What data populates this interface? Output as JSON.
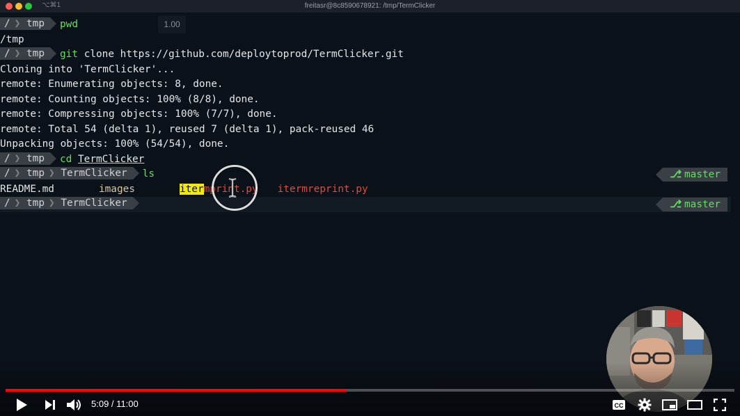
{
  "window": {
    "title": "freitasr@8c8590678921: /tmp/TermClicker",
    "tab_shortcut": "⌥⌘1"
  },
  "speed_badge": "1.00",
  "prompt": {
    "root": "/",
    "dir_tmp": "tmp",
    "dir_repo": "TermClicker",
    "branch": "master"
  },
  "terminal": {
    "cmd_pwd": "pwd",
    "out_pwd": "/tmp",
    "cmd_git": "git",
    "arg_git": "clone https://github.com/deploytoprod/TermClicker.git",
    "out_lines": [
      "Cloning into 'TermClicker'...",
      "remote: Enumerating objects: 8, done.",
      "remote: Counting objects: 100% (8/8), done.",
      "remote: Compressing objects: 100% (7/7), done.",
      "remote: Total 54 (delta 1), reused 7 (delta 1), pack-reused 46",
      "Unpacking objects: 100% (54/54), done."
    ],
    "cmd_cd": "cd",
    "arg_cd": "TermClicker",
    "cmd_ls": "ls",
    "ls_items": {
      "readme": "README.md",
      "images": "images",
      "py1_match": "iter",
      "py1_rest": "mprint.py",
      "py2": "itermreprint.py"
    }
  },
  "player": {
    "time_current": "5:09",
    "time_separator": " / ",
    "time_total": "11:00",
    "progress_fraction": 0.468,
    "accent_color": "#ff0000"
  },
  "icons": {
    "play": "play-icon",
    "next": "next-icon",
    "volume": "volume-icon",
    "cc": "captions-icon",
    "settings": "gear-icon",
    "miniplayer": "miniplayer-icon",
    "theater": "theater-icon",
    "fullscreen": "fullscreen-icon",
    "branch": "git-branch-icon"
  }
}
